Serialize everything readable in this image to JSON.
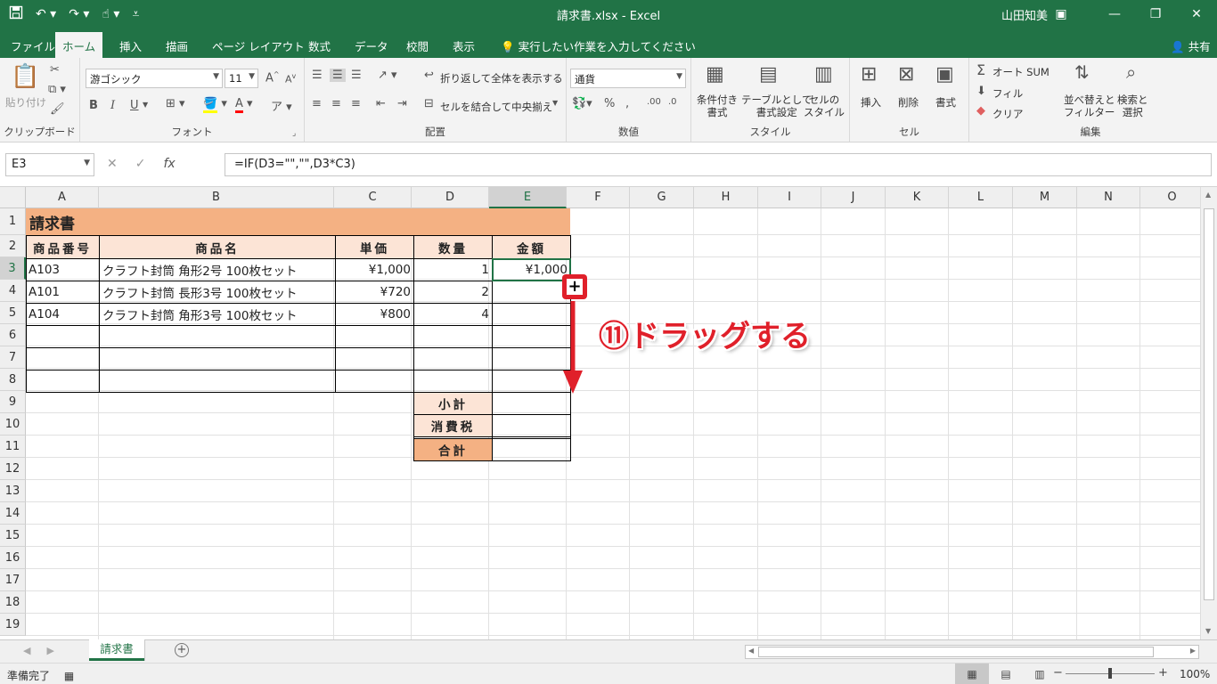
{
  "titlebar": {
    "title": "請求書.xlsx  -  Excel",
    "user": "山田知美"
  },
  "tabs": [
    "ファイル",
    "ホーム",
    "挿入",
    "描画",
    "ページ レイアウト",
    "数式",
    "データ",
    "校閲",
    "表示"
  ],
  "tell_me": "実行したい作業を入力してください",
  "share": "共有",
  "ribbon": {
    "clipboard": {
      "paste": "貼り付け",
      "label": "クリップボード"
    },
    "font": {
      "name": "游ゴシック",
      "size": "11",
      "label": "フォント",
      "bold": "B",
      "italic": "I",
      "underline": "U"
    },
    "alignment": {
      "wrap": "折り返して全体を表示する",
      "merge": "セルを結合して中央揃え",
      "label": "配置"
    },
    "number": {
      "format": "通貨",
      "percent": "%",
      "label": "数値"
    },
    "styles": {
      "conditional": "条件付き\n書式",
      "table": "テーブルとして\n書式設定",
      "cell": "セルの\nスタイル",
      "label": "スタイル"
    },
    "cells": {
      "insert": "挿入",
      "delete": "削除",
      "format": "書式",
      "label": "セル"
    },
    "editing": {
      "autosum": "オート SUM",
      "fill": "フィル",
      "clear": "クリア",
      "sort": "並べ替えと\nフィルター",
      "find": "検索と\n選択",
      "label": "編集"
    }
  },
  "formula_bar": {
    "name_box": "E3",
    "formula": "=IF(D3=\"\",\"\",D3*C3)"
  },
  "columns": [
    "A",
    "B",
    "C",
    "D",
    "E",
    "F",
    "G",
    "H",
    "I",
    "J",
    "K",
    "L",
    "M",
    "N",
    "O"
  ],
  "rows": [
    "1",
    "2",
    "3",
    "4",
    "5",
    "6",
    "7",
    "8",
    "9",
    "10",
    "11",
    "12",
    "13",
    "14",
    "15",
    "16",
    "17",
    "18",
    "19"
  ],
  "sheet": {
    "title": "請求書",
    "headers": [
      "商品番号",
      "商品名",
      "単価",
      "数量",
      "金額"
    ],
    "items": [
      {
        "code": "A103",
        "name": "クラフト封筒 角形2号 100枚セット",
        "price": "¥1,000",
        "qty": "1",
        "amount": "¥1,000"
      },
      {
        "code": "A101",
        "name": "クラフト封筒 長形3号 100枚セット",
        "price": "¥720",
        "qty": "2",
        "amount": ""
      },
      {
        "code": "A104",
        "name": "クラフト封筒 角形3号 100枚セット",
        "price": "¥800",
        "qty": "4",
        "amount": ""
      }
    ],
    "subtotal": "小計",
    "tax": "消費税",
    "total": "合計"
  },
  "sheet_tab": "請求書",
  "status": {
    "ready": "準備完了",
    "zoom": "100%"
  },
  "annotation": "⑪ドラッグする",
  "colors": {
    "excel_green": "#217346",
    "title_fill": "#f4b183",
    "header_fill": "#fce4d6",
    "total_fill": "#f4b183",
    "annotation_red": "#e0202a"
  }
}
